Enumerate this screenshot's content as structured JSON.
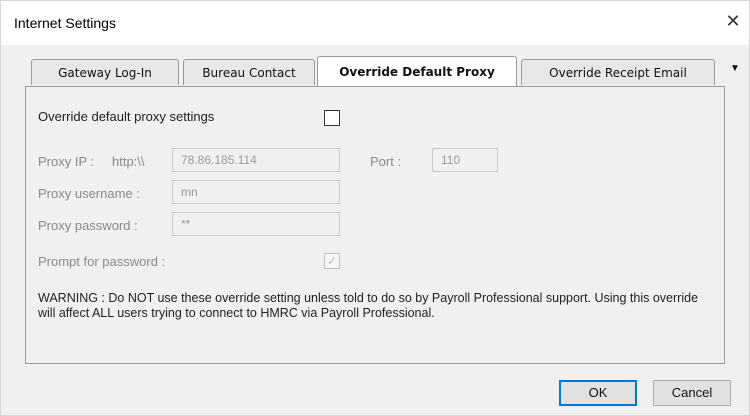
{
  "window": {
    "title": "Internet Settings",
    "close_glyph": "✕"
  },
  "tabs": [
    {
      "label": "Gateway Log-In",
      "active": false
    },
    {
      "label": "Bureau Contact",
      "active": false
    },
    {
      "label": "Override Default Proxy",
      "active": true
    },
    {
      "label": "Override Receipt Email",
      "active": false
    }
  ],
  "tab_overflow_glyph": "▼",
  "form": {
    "override_label": "Override default proxy settings",
    "override_checked": false,
    "proxy_ip_label": "Proxy IP :",
    "proxy_ip_prefix": "http:\\\\",
    "proxy_ip_value": "78.86.185.114",
    "port_label": "Port :",
    "port_value": "110",
    "username_label": "Proxy username :",
    "username_value": "mn",
    "password_label": "Proxy password :",
    "password_value": "**",
    "prompt_label": "Prompt for password :",
    "prompt_checked": true,
    "check_glyph": "✓"
  },
  "warning": "WARNING : Do NOT use these override setting unless told to do so by Payroll Professional support. Using this override will affect ALL users trying to connect to HMRC via Payroll Professional.",
  "buttons": {
    "ok": "OK",
    "cancel": "Cancel"
  }
}
